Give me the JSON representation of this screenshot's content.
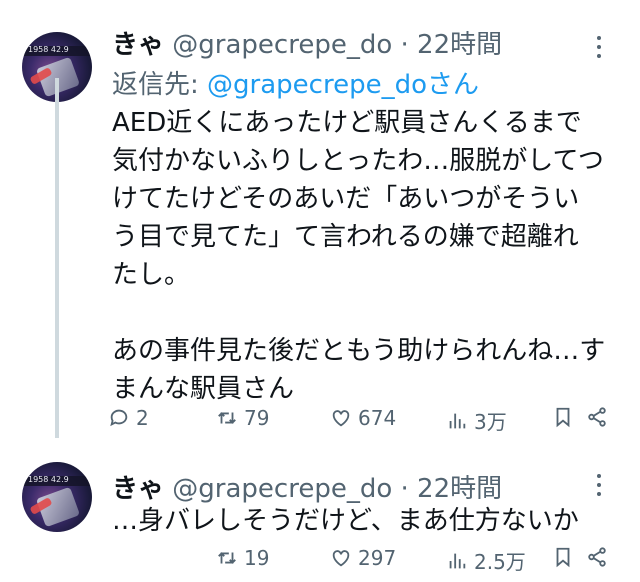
{
  "tweets": [
    {
      "display_name": "きゃ",
      "handle": "@grapecrepe_do",
      "separator": "·",
      "time": "22時間",
      "avatar_text": "1958 42.9",
      "reply_prefix": "返信先:",
      "reply_to": "@grapecrepe_do",
      "reply_suffix": "さん",
      "body_lines": [
        "AED近くにあったけど駅員さんくるまで",
        "気付かないふりしとったわ…服脱がしてつ",
        "けてたけどそのあいだ「あいつがそうい",
        "う目で見てた」て言われるの嫌で超離れ",
        "たし。",
        "",
        "あの事件見た後だともう助けられんね…す",
        "まんな駅員さん"
      ],
      "actions": {
        "replies": "2",
        "retweets": "79",
        "likes": "674",
        "views": "3万"
      }
    },
    {
      "display_name": "きゃ",
      "handle": "@grapecrepe_do",
      "separator": "·",
      "time": "22時間",
      "avatar_text": "1958 42.9",
      "body_lines": [
        "…身バレしそうだけど、まあ仕方ないか"
      ],
      "actions": {
        "retweets": "19",
        "likes": "297",
        "views": "2.5万"
      }
    }
  ],
  "icons": {
    "reply": "reply-icon",
    "retweet": "retweet-icon",
    "like": "heart-icon",
    "views": "views-icon",
    "bookmark": "bookmark-icon",
    "share": "share-icon",
    "more": "more-icon"
  },
  "colors": {
    "text": "#0f1419",
    "muted": "#536471",
    "link": "#1d9bf0",
    "thread_line": "#cfd9de"
  }
}
